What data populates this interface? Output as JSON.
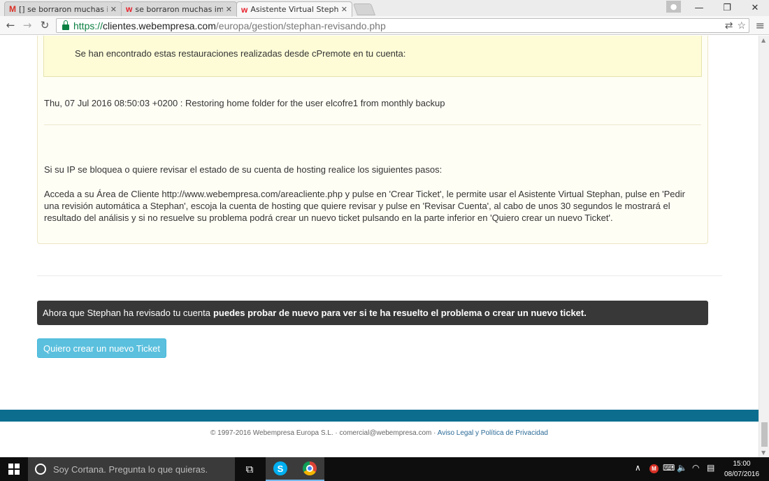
{
  "browser": {
    "tabs": [
      {
        "favicon": "gmail-icon",
        "title": "[] se borraron muchas imá"
      },
      {
        "favicon": "webempresa-icon",
        "title": "se borraron muchas imág"
      },
      {
        "favicon": "webempresa-icon",
        "title": "Asistente Virtual Stephan",
        "active": true
      }
    ],
    "url": {
      "scheme": "https://",
      "host": "clientes.webempresa.com",
      "path": "/europa/gestion/stephan-revisando.php"
    }
  },
  "page": {
    "alert_text": "Se han encontrado estas restauraciones realizadas desde cPremote en tu cuenta:",
    "restore_entry": "Thu, 07 Jul 2016 08:50:03 +0200 : Restoring home folder for the user elcofre1 from monthly backup",
    "ip_intro": "Si su IP se bloquea o quiere revisar el estado de su cuenta de hosting realice los siguientes pasos:",
    "ip_steps": "Acceda a su Área de Cliente http://www.webempresa.com/areacliente.php y pulse en 'Crear Ticket', le permite usar el Asistente Virtual Stephan, pulse en 'Pedir una revisión automática a Stephan', escoja la cuenta de hosting que quiere revisar y pulse en 'Revisar Cuenta', al cabo de unos 30 segundos le mostrará el resultado del análisis y si no resuelve su problema podrá crear un nuevo ticket pulsando en la parte inferior en 'Quiero crear un nuevo Ticket'.",
    "banner_normal": "Ahora que Stephan ha revisado tu cuenta",
    "banner_bold": "puedes probar de nuevo para ver si te ha resuelto el problema o crear un nuevo ticket.",
    "ticket_button": "Quiero crear un nuevo Ticket",
    "footer_text": "© 1997-2016 Webempresa Europa S.L. · comercial@webempresa.com ·",
    "footer_link": "Aviso Legal y Política de Privacidad"
  },
  "taskbar": {
    "cortana_placeholder": "Soy Cortana. Pregunta lo que quieras.",
    "clock_time": "15:00",
    "clock_date": "08/07/2016"
  },
  "colors": {
    "footer_bar": "#0c6d8f",
    "ticket_button": "#5bc0de",
    "banner": "#383838"
  }
}
